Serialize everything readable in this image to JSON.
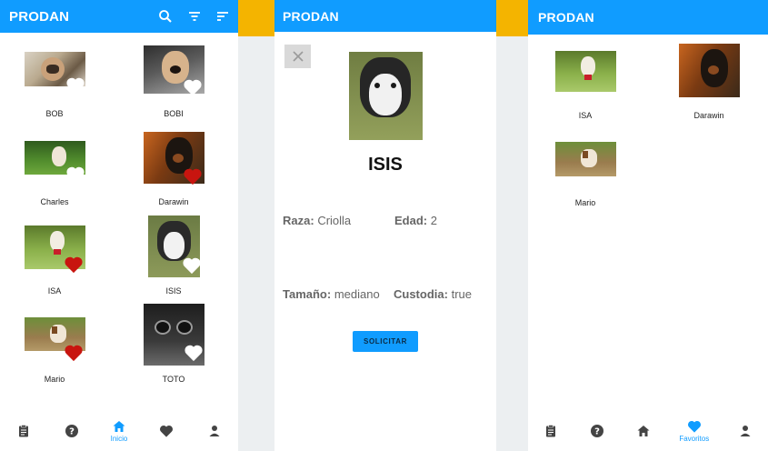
{
  "app_title": "PRODAN",
  "colors": {
    "primary": "#109cff",
    "accent_bar": "#f4b400",
    "heart_fav": "#c8150f",
    "heart_empty": "#ffffff"
  },
  "screen1": {
    "title": "PRODAN",
    "actions": [
      "search-icon",
      "filter-icon",
      "sort-icon"
    ],
    "pets": [
      {
        "name": "BOB",
        "favorite": false
      },
      {
        "name": "BOBI",
        "favorite": false
      },
      {
        "name": "Charles",
        "favorite": false
      },
      {
        "name": "Darawin",
        "favorite": true
      },
      {
        "name": "ISA",
        "favorite": true
      },
      {
        "name": "ISIS",
        "favorite": false
      },
      {
        "name": "Mario",
        "favorite": true
      },
      {
        "name": "TOTO",
        "favorite": false
      }
    ],
    "nav": {
      "active_label": "Inicio"
    }
  },
  "screen2": {
    "title": "PRODAN",
    "pet_name": "ISIS",
    "breed_label": "Raza:",
    "breed_value": "Criolla",
    "age_label": "Edad:",
    "age_value": "2",
    "size_label": "Tamaño:",
    "size_value": "mediano",
    "custody_label": "Custodia:",
    "custody_value": "true",
    "request_button": "SOLICITAR"
  },
  "screen3": {
    "title": "PRODAN",
    "favorites": [
      "ISA",
      "Darawin",
      "Mario"
    ],
    "nav": {
      "active_label": "Favoritos"
    }
  }
}
